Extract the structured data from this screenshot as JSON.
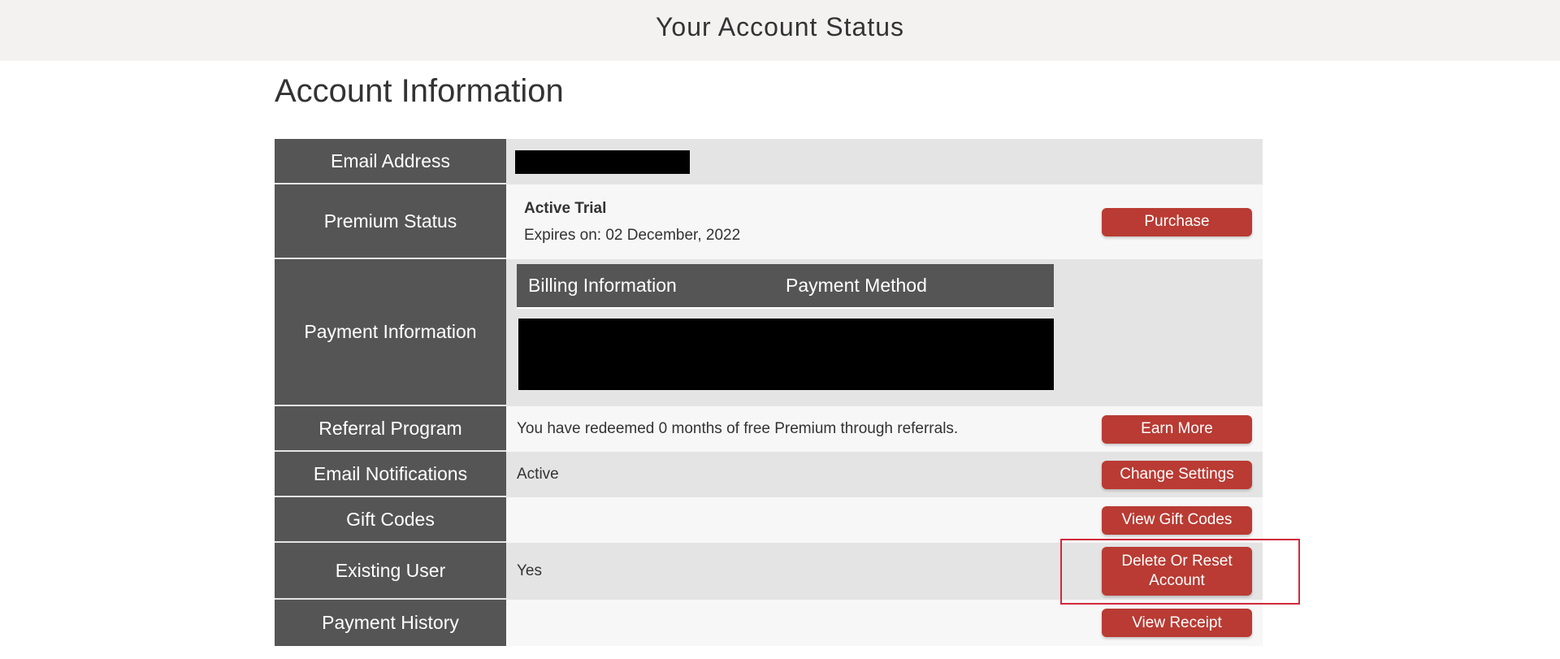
{
  "header": {
    "title": "Your Account Status"
  },
  "page": {
    "section_title": "Account Information"
  },
  "colors": {
    "accent_button": "#b93b33",
    "label_bg": "#555555",
    "highlight_border": "#d1293c"
  },
  "rows": {
    "email": {
      "label": "Email Address",
      "value": "[redacted]"
    },
    "premium": {
      "label": "Premium Status",
      "status": "Active Trial",
      "expires": "Expires on: 02 December, 2022",
      "button": "Purchase"
    },
    "payment": {
      "label": "Payment Information",
      "columns": [
        "Billing Information",
        "Payment Method"
      ],
      "body": "[redacted]"
    },
    "referral": {
      "label": "Referral Program",
      "value": "You have redeemed 0 months of free Premium through referrals.",
      "button": "Earn More"
    },
    "notifications": {
      "label": "Email Notifications",
      "value": "Active",
      "button": "Change Settings"
    },
    "gift": {
      "label": "Gift Codes",
      "value": "",
      "button": "View Gift Codes"
    },
    "existing": {
      "label": "Existing User",
      "value": "Yes",
      "button": "Delete Or Reset Account"
    },
    "history": {
      "label": "Payment History",
      "value": "",
      "button": "View Receipt"
    }
  }
}
